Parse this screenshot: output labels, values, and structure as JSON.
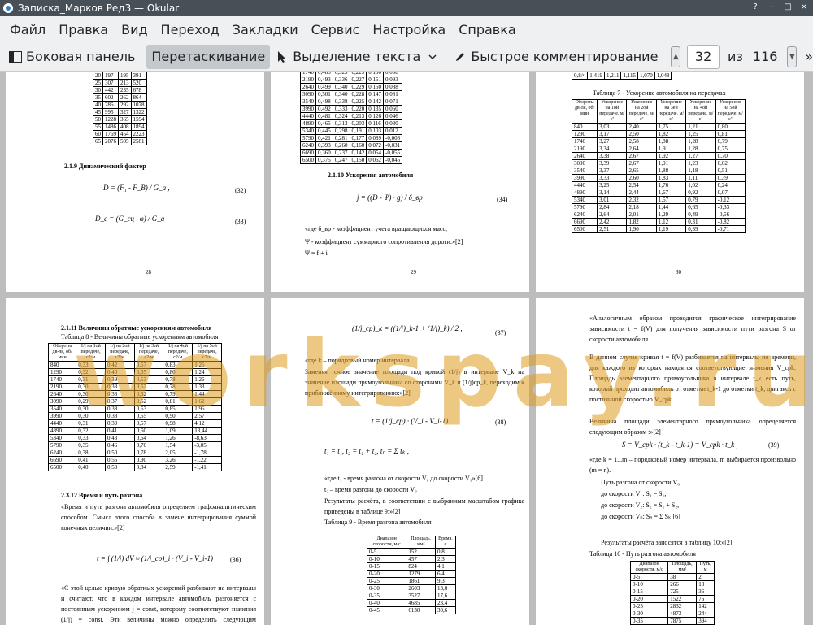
{
  "window": {
    "title": "Записка_Марков Ред3  — Okular",
    "controls": [
      "?",
      "–",
      "□",
      "×"
    ]
  },
  "menu": [
    "Файл",
    "Правка",
    "Вид",
    "Переход",
    "Закладки",
    "Сервис",
    "Настройка",
    "Справка"
  ],
  "toolbar": {
    "sidebar": "Боковая панель",
    "drag": "Перетаскивание",
    "text_select": "Выделение текста",
    "quick_comment": "Быстрое комментирование",
    "current_page": "32",
    "of_label": "из",
    "total_pages": "116",
    "more": "»"
  },
  "watermark": "workspay.ru",
  "page28": {
    "table_rows": [
      [
        "20",
        "197",
        "195",
        "391"
      ],
      [
        "25",
        "307",
        "213",
        "520"
      ],
      [
        "30",
        "442",
        "235",
        "678"
      ],
      [
        "35",
        "602",
        "262",
        "864"
      ],
      [
        "40",
        "786",
        "292",
        "1078"
      ],
      [
        "45",
        "995",
        "327",
        "1322"
      ],
      [
        "50",
        "1228",
        "365",
        "1594"
      ],
      [
        "55",
        "1486",
        "408",
        "1894"
      ],
      [
        "60",
        "1769",
        "454",
        "2223"
      ],
      [
        "65",
        "2076",
        "505",
        "2581"
      ]
    ],
    "heading": "2.1.9 Динамический фактор",
    "formula1": "D = (F₁ - F_B) / G_a ,",
    "formula1_num": "(32)",
    "formula2": "D_c = (G_сц · φ) / G_a",
    "formula2_num": "(33)",
    "page_number": "28"
  },
  "page29": {
    "table_rows": [
      [
        "1740",
        "0,483",
        "0,329",
        "0,229",
        "0,150",
        "0,098"
      ],
      [
        "2190",
        "0,493",
        "0,336",
        "0,227",
        "0,151",
        "0,093"
      ],
      [
        "2640",
        "0,499",
        "0,340",
        "0,229",
        "0,150",
        "0,088"
      ],
      [
        "3090",
        "0,501",
        "0,340",
        "0,228",
        "0,147",
        "0,081"
      ],
      [
        "3540",
        "0,498",
        "0,338",
        "0,225",
        "0,142",
        "0,071"
      ],
      [
        "3990",
        "0,492",
        "0,333",
        "0,220",
        "0,135",
        "0,060"
      ],
      [
        "4440",
        "0,481",
        "0,324",
        "0,213",
        "0,126",
        "0,046"
      ],
      [
        "4890",
        "0,465",
        "0,313",
        "0,203",
        "0,116",
        "0,030"
      ],
      [
        "5340",
        "0,445",
        "0,298",
        "0,191",
        "0,103",
        "0,012"
      ],
      [
        "5790",
        "0,421",
        "0,281",
        "0,177",
        "0,089",
        "-0,008"
      ],
      [
        "6240",
        "0,393",
        "0,260",
        "0,160",
        "0,072",
        "-0,031"
      ],
      [
        "6690",
        "0,360",
        "0,237",
        "0,142",
        "0,054",
        "-0,055"
      ],
      [
        "6500",
        "0,375",
        "0,247",
        "0,150",
        "0,062",
        "-0,045"
      ]
    ],
    "heading": "2.1.10 Ускорения автомобиля",
    "formula": "j = ((D - Ψ) · g) / δ_вр",
    "formula_num": "(34)",
    "line1": "«где  δ_вр - коэффициент  учета вращающихся масс,",
    "line2": "Ψ  - коэффициент суммарного сопротивления дороги.»[2]",
    "line3": "Ψ = f + i",
    "page_number": "29"
  },
  "page30": {
    "top_row": [
      "0,8/ч",
      "1,419",
      "1,211",
      "1,115",
      "1,070",
      "1,048"
    ],
    "caption": "Таблица 7 - Ускорение автомобиля на передачах",
    "headers": [
      "Обороты дв-ля, об/мин",
      "Ускорение на 1ой передаче, м/с²",
      "Ускорение на 2ой передаче, м/с²",
      "Ускорение на 3ей передаче, м/с²",
      "Ускорение на 4ой передаче, м/с²",
      "Ускорение на 5ой передаче, м/с²"
    ],
    "rows": [
      [
        "840",
        "3,03",
        "2,40",
        "1,75",
        "1,21",
        "0,80"
      ],
      [
        "1290",
        "3,17",
        "2,50",
        "1,82",
        "1,25",
        "0,81"
      ],
      [
        "1740",
        "3,27",
        "2,58",
        "1,88",
        "1,28",
        "0,79"
      ],
      [
        "2190",
        "3,34",
        "2,64",
        "1,91",
        "1,28",
        "0,75"
      ],
      [
        "2640",
        "3,38",
        "2,67",
        "1,92",
        "1,27",
        "0,70"
      ],
      [
        "3090",
        "3,39",
        "2,67",
        "1,91",
        "1,23",
        "0,62"
      ],
      [
        "3540",
        "3,37",
        "2,65",
        "1,88",
        "1,18",
        "0,51"
      ],
      [
        "3990",
        "3,33",
        "2,60",
        "1,83",
        "1,11",
        "0,39"
      ],
      [
        "4440",
        "3,25",
        "2,54",
        "1,76",
        "1,02",
        "0,24"
      ],
      [
        "4890",
        "3,14",
        "2,44",
        "1,67",
        "0,92",
        "0,07"
      ],
      [
        "5340",
        "3,01",
        "2,32",
        "1,57",
        "0,79",
        "-0,12"
      ],
      [
        "5790",
        "2,84",
        "2,18",
        "1,44",
        "0,65",
        "-0,33"
      ],
      [
        "6240",
        "2,64",
        "2,01",
        "1,29",
        "0,49",
        "-0,56"
      ],
      [
        "6690",
        "2,42",
        "1,82",
        "1,12",
        "0,31",
        "-0,82"
      ],
      [
        "6500",
        "2,51",
        "1,90",
        "1,19",
        "0,39",
        "-0,71"
      ]
    ],
    "page_number": "30"
  },
  "page31": {
    "heading": "2.1.11 Величины обратные ускорениям автомобиля",
    "caption": "Таблица 8 - Величины обратные ускорениям автомобиля",
    "headers": [
      "Обороты дв-ля, об/мин",
      "1/j на 1ой передаче, с2/м",
      "1/j на 2ой передаче, с2/м",
      "1/j на 3ей передаче, с2/м",
      "1/j на 4ой передаче, с2/м",
      "1/j на 5ой передаче, с2/м"
    ],
    "rows": [
      [
        "840",
        "0,33",
        "0,42",
        "0,57",
        "0,83",
        "1,25"
      ],
      [
        "1290",
        "0,32",
        "0,40",
        "0,55",
        "0,80",
        "1,24"
      ],
      [
        "1740",
        "0,31",
        "0,39",
        "0,53",
        "0,78",
        "1,26"
      ],
      [
        "2190",
        "0,30",
        "0,38",
        "0,52",
        "0,78",
        "1,33"
      ],
      [
        "2640",
        "0,30",
        "0,38",
        "0,52",
        "0,79",
        "1,44"
      ],
      [
        "3090",
        "0,29",
        "0,37",
        "0,52",
        "0,81",
        "1,62"
      ],
      [
        "3540",
        "0,30",
        "0,38",
        "0,53",
        "0,85",
        "1,95"
      ],
      [
        "3990",
        "0,30",
        "0,38",
        "0,55",
        "0,90",
        "2,57"
      ],
      [
        "4440",
        "0,31",
        "0,39",
        "0,57",
        "0,98",
        "4,12"
      ],
      [
        "4890",
        "0,32",
        "0,41",
        "0,60",
        "1,09",
        "13,44"
      ],
      [
        "5340",
        "0,33",
        "0,43",
        "0,64",
        "1,26",
        "-8,63"
      ],
      [
        "5790",
        "0,35",
        "0,46",
        "0,70",
        "1,54",
        "-3,05"
      ],
      [
        "6240",
        "0,38",
        "0,50",
        "0,78",
        "2,05",
        "-1,78"
      ],
      [
        "6690",
        "0,41",
        "0,55",
        "0,90",
        "3,26",
        "-1,22"
      ],
      [
        "6500",
        "0,40",
        "0,53",
        "0,84",
        "2,59",
        "-1,41"
      ]
    ],
    "heading2": "2.3.12 Время и путь разгона",
    "para1": "«Время и путь разгона автомобиля определяем графоаналитическим способом. Смысл этого способа в замене интегрирования суммой конечных величин:»[2]",
    "formula": "t = ∫ (1/j) dV ≈ (1/j_ср)_i · (V_i - V_i-1)",
    "formula_num": "(36)",
    "para2": "«С этой целью кривую обратных ускорений разбивают на интервалы и считают, что в каждом интервале автомобиль разгоняется с постоянным ускорением        j = const, которому соответствуют значения (1/j) = const. Эти величины можно определить следующим образом:»[2]"
  },
  "page32": {
    "formula_top": "(1/j_ср)_k = ((1/j)_k-1 + (1/j)_k) / 2 ,",
    "formula_top_num": "(37)",
    "line1": "«где k – порядковый номер интервала.",
    "para1": "Заменяя точное значение площади под кривой (1/j) в интервале  V_k на значение площади прямоугольника со сторонами  V_k и (1/j)ср_k, переходим к приближённому интегрированию:»[2]",
    "formula": "t = (1/j_ср) · (V_i - V_i-1)",
    "formula_num": "(38)",
    "formula_seq": "t₁ =   t₁,  t₂ =   t₁ +   t₂,  tₙ = Σ tₖ ,",
    "line2": "«где t₁ - время разгона от скорости V₀ до скорости V₁»[6]",
    "line3": "t₂ – время разгона до скорости V₂",
    "para2": "Результаты расчёта, в соответствии с выбранным масштабом графика приведены в таблице 9:»[2]",
    "caption": "Таблица 9 - Время разгона автомобиля",
    "headers": [
      "Диапазон скорости, м/с",
      "Площадь, мм²",
      "Время, с"
    ],
    "rows": [
      [
        "0-5",
        "152",
        "0,8"
      ],
      [
        "0-10",
        "457",
        "2,3"
      ],
      [
        "0-15",
        "824",
        "4,1"
      ],
      [
        "0-20",
        "1279",
        "6,4"
      ],
      [
        "0-25",
        "1861",
        "9,3"
      ],
      [
        "0-30",
        "2603",
        "13,0"
      ],
      [
        "0-35",
        "3527",
        "17,6"
      ],
      [
        "0-40",
        "4685",
        "23,4"
      ],
      [
        "0-45",
        "6130",
        "30,6"
      ]
    ]
  },
  "page33": {
    "para1": "«Аналогичным образом проводится графическое интегрирование зависимости t = f(V) для получения зависимости пути разгона S от скорости автомобиля.",
    "para2": "В данном случае кривая t = f(V) разбивается на интервалы по времени, для каждого из которых находятся соответствующие значения V_срk. Площадь элементарного прямоугольника в интервале  t_k есть путь, который проходит автомобиль от отметки t_k-1 до отметки t_k, двигаясь с постоянной скоростью V_срk.",
    "para3": "Величина площади элементарного прямоугольника определяется следующим образом :»[2]",
    "formula": "S = V_срk · (t_k - t_k-1) = V_срk ·  t_k ,",
    "formula_num": "(39)",
    "line1": "«где  k = 1...m – порядковый номер интервала, m выбирается произвольно     (m = n).",
    "line2": "Путь разгона от скорости V₀",
    "line3": "до скорости V₁: S₁ =  S₁,",
    "line4": "до скорости V₂: S₂ =  S₁ +   S₂,",
    "line5": "до скорости Vₙ: Sₙ = Σ Sₖ      [6]",
    "line6": "Результаты расчёта заносятся в таблицу 10:»[2]",
    "caption": "Таблица 10 - Путь разгона автомобиля",
    "headers": [
      "Диапазон скорости, м/с",
      "Площадь, мм²",
      "Путь, м"
    ],
    "rows": [
      [
        "0-5",
        "38",
        "2"
      ],
      [
        "0-10",
        "266",
        "13"
      ],
      [
        "0-15",
        "725",
        "36"
      ],
      [
        "0-20",
        "1522",
        "76"
      ],
      [
        "0-25",
        "2832",
        "142"
      ],
      [
        "0-30",
        "4873",
        "244"
      ],
      [
        "0-35",
        "7875",
        "394"
      ]
    ]
  }
}
